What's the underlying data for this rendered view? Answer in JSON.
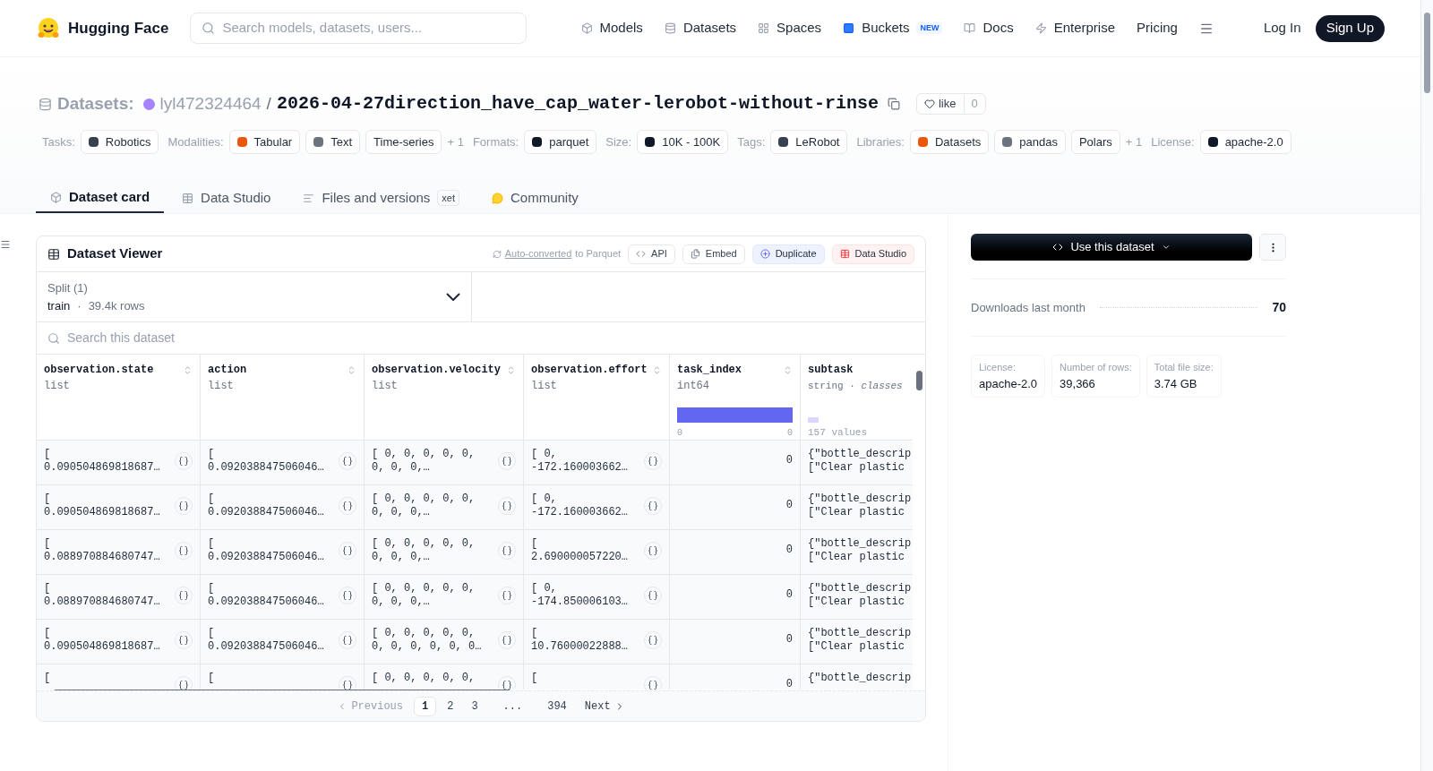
{
  "header": {
    "brand": "Hugging Face",
    "search": {
      "placeholder": "Search models, datasets, users..."
    },
    "nav": [
      {
        "label": "Models"
      },
      {
        "label": "Datasets"
      },
      {
        "label": "Spaces"
      },
      {
        "label": "Buckets",
        "badge": "NEW"
      },
      {
        "label": "Docs"
      },
      {
        "label": "Enterprise"
      },
      {
        "label": "Pricing"
      }
    ],
    "login": "Log In",
    "signup": "Sign Up"
  },
  "repo": {
    "type": "Datasets:",
    "owner": "lyl472324464",
    "separator": "/",
    "name": "2026-04-27direction_have_cap_water-lerobot-without-rinse",
    "like": "like",
    "likes": "0"
  },
  "tags": [
    {
      "kind": "label",
      "text": "Tasks:"
    },
    {
      "kind": "chip",
      "text": "Robotics"
    },
    {
      "kind": "label",
      "text": "Modalities:"
    },
    {
      "kind": "chip",
      "text": "Tabular"
    },
    {
      "kind": "chip",
      "text": "Text"
    },
    {
      "kind": "chip",
      "text": "Time-series"
    },
    {
      "kind": "more",
      "text": "+ 1"
    },
    {
      "kind": "label",
      "text": "Formats:"
    },
    {
      "kind": "chip",
      "text": "parquet"
    },
    {
      "kind": "label",
      "text": "Size:"
    },
    {
      "kind": "chip",
      "text": "10K - 100K"
    },
    {
      "kind": "label",
      "text": "Tags:"
    },
    {
      "kind": "chip",
      "text": "LeRobot"
    },
    {
      "kind": "label",
      "text": "Libraries:"
    },
    {
      "kind": "chip",
      "text": "Datasets"
    },
    {
      "kind": "chip",
      "text": "pandas"
    },
    {
      "kind": "chip",
      "text": "Polars"
    },
    {
      "kind": "more",
      "text": "+ 1"
    },
    {
      "kind": "label",
      "text": "License:"
    },
    {
      "kind": "chip",
      "text": "apache-2.0"
    }
  ],
  "tabs": [
    {
      "label": "Dataset card",
      "selected": true
    },
    {
      "label": "Data Studio",
      "selected": false
    },
    {
      "label": "Files and versions",
      "badge": "xet",
      "selected": false
    },
    {
      "label": "Community",
      "selected": false
    }
  ],
  "viewer": {
    "title": "Dataset Viewer",
    "converted_link": "Auto-converted",
    "converted_rest": "to Parquet",
    "buttons": [
      {
        "label": "API"
      },
      {
        "label": "Embed"
      },
      {
        "label": "Duplicate"
      },
      {
        "label": "Data Studio"
      }
    ],
    "split": {
      "label": "Split (1)",
      "name": "train",
      "dot": "·",
      "rows": "39.4k rows"
    },
    "search": {
      "placeholder": "Search this dataset"
    },
    "columns": [
      {
        "name": "observation.state",
        "type": "list"
      },
      {
        "name": "action",
        "type": "list"
      },
      {
        "name": "observation.velocity",
        "type": "list"
      },
      {
        "name": "observation.effort",
        "type": "list"
      },
      {
        "name": "task_index",
        "type": "int64",
        "hist_min": "0",
        "hist_max": "0"
      },
      {
        "name": "subtask",
        "type": "string · *classes*",
        "values": "157 values"
      }
    ],
    "rows": [
      [
        [
          "[",
          "0.090504869818687…"
        ],
        [
          "[",
          "0.092038847506046…"
        ],
        [
          "[ 0, 0, 0, 0, 0,",
          "0, 0, 0,…"
        ],
        [
          "[ 0,",
          "-172.160003662…"
        ],
        [
          "0"
        ],
        [
          "{\"bottle_descrip",
          "[\"Clear plastic"
        ]
      ],
      [
        [
          "[",
          "0.090504869818687…"
        ],
        [
          "[",
          "0.092038847506046…"
        ],
        [
          "[ 0, 0, 0, 0, 0,",
          "0, 0, 0,…"
        ],
        [
          "[ 0,",
          "-172.160003662…"
        ],
        [
          "0"
        ],
        [
          "{\"bottle_descrip",
          "[\"Clear plastic"
        ]
      ],
      [
        [
          "[",
          "0.088970884680747…"
        ],
        [
          "[",
          "0.092038847506046…"
        ],
        [
          "[ 0, 0, 0, 0, 0,",
          "0, 0, 0,…"
        ],
        [
          "[",
          "2.690000057220…"
        ],
        [
          "0"
        ],
        [
          "{\"bottle_descrip",
          "[\"Clear plastic"
        ]
      ],
      [
        [
          "[",
          "0.088970884680747…"
        ],
        [
          "[",
          "0.092038847506046…"
        ],
        [
          "[ 0, 0, 0, 0, 0,",
          "0, 0, 0,…"
        ],
        [
          "[ 0,",
          "-174.850006103…"
        ],
        [
          "0"
        ],
        [
          "{\"bottle_descrip",
          "[\"Clear plastic"
        ]
      ],
      [
        [
          "[",
          "0.090504869818687…"
        ],
        [
          "[",
          "0.092038847506046…"
        ],
        [
          "[ 0, 0, 0, 0, 0,",
          "0, 0, 0, 0, 0, 0…"
        ],
        [
          "[",
          "10.76000022888…"
        ],
        [
          "0"
        ],
        [
          "{\"bottle_descrip",
          "[\"Clear plastic"
        ]
      ],
      [
        [
          "["
        ],
        [
          "["
        ],
        [
          "[ 0, 0, 0, 0, 0,"
        ],
        [
          "["
        ],
        [
          "0"
        ],
        [
          "{\"bottle_descrip"
        ]
      ]
    ],
    "pagination": [
      {
        "label": "Previous",
        "kind": "prev",
        "selected": false
      },
      {
        "label": "1",
        "kind": "page",
        "selected": true
      },
      {
        "label": "2",
        "kind": "page",
        "selected": false
      },
      {
        "label": "3",
        "kind": "page",
        "selected": false
      },
      {
        "label": "...",
        "kind": "gap",
        "selected": false
      },
      {
        "label": "394",
        "kind": "page",
        "selected": false
      },
      {
        "label": "Next",
        "kind": "next",
        "selected": false
      }
    ]
  },
  "side": {
    "use_button": "Use this dataset",
    "downloads_label": "Downloads last month",
    "downloads": "70",
    "stats": [
      {
        "label": "License:",
        "value": "apache-2.0"
      },
      {
        "label": "Number of rows:",
        "value": "39,366"
      },
      {
        "label": "Total file size:",
        "value": "3.74 GB"
      }
    ]
  }
}
